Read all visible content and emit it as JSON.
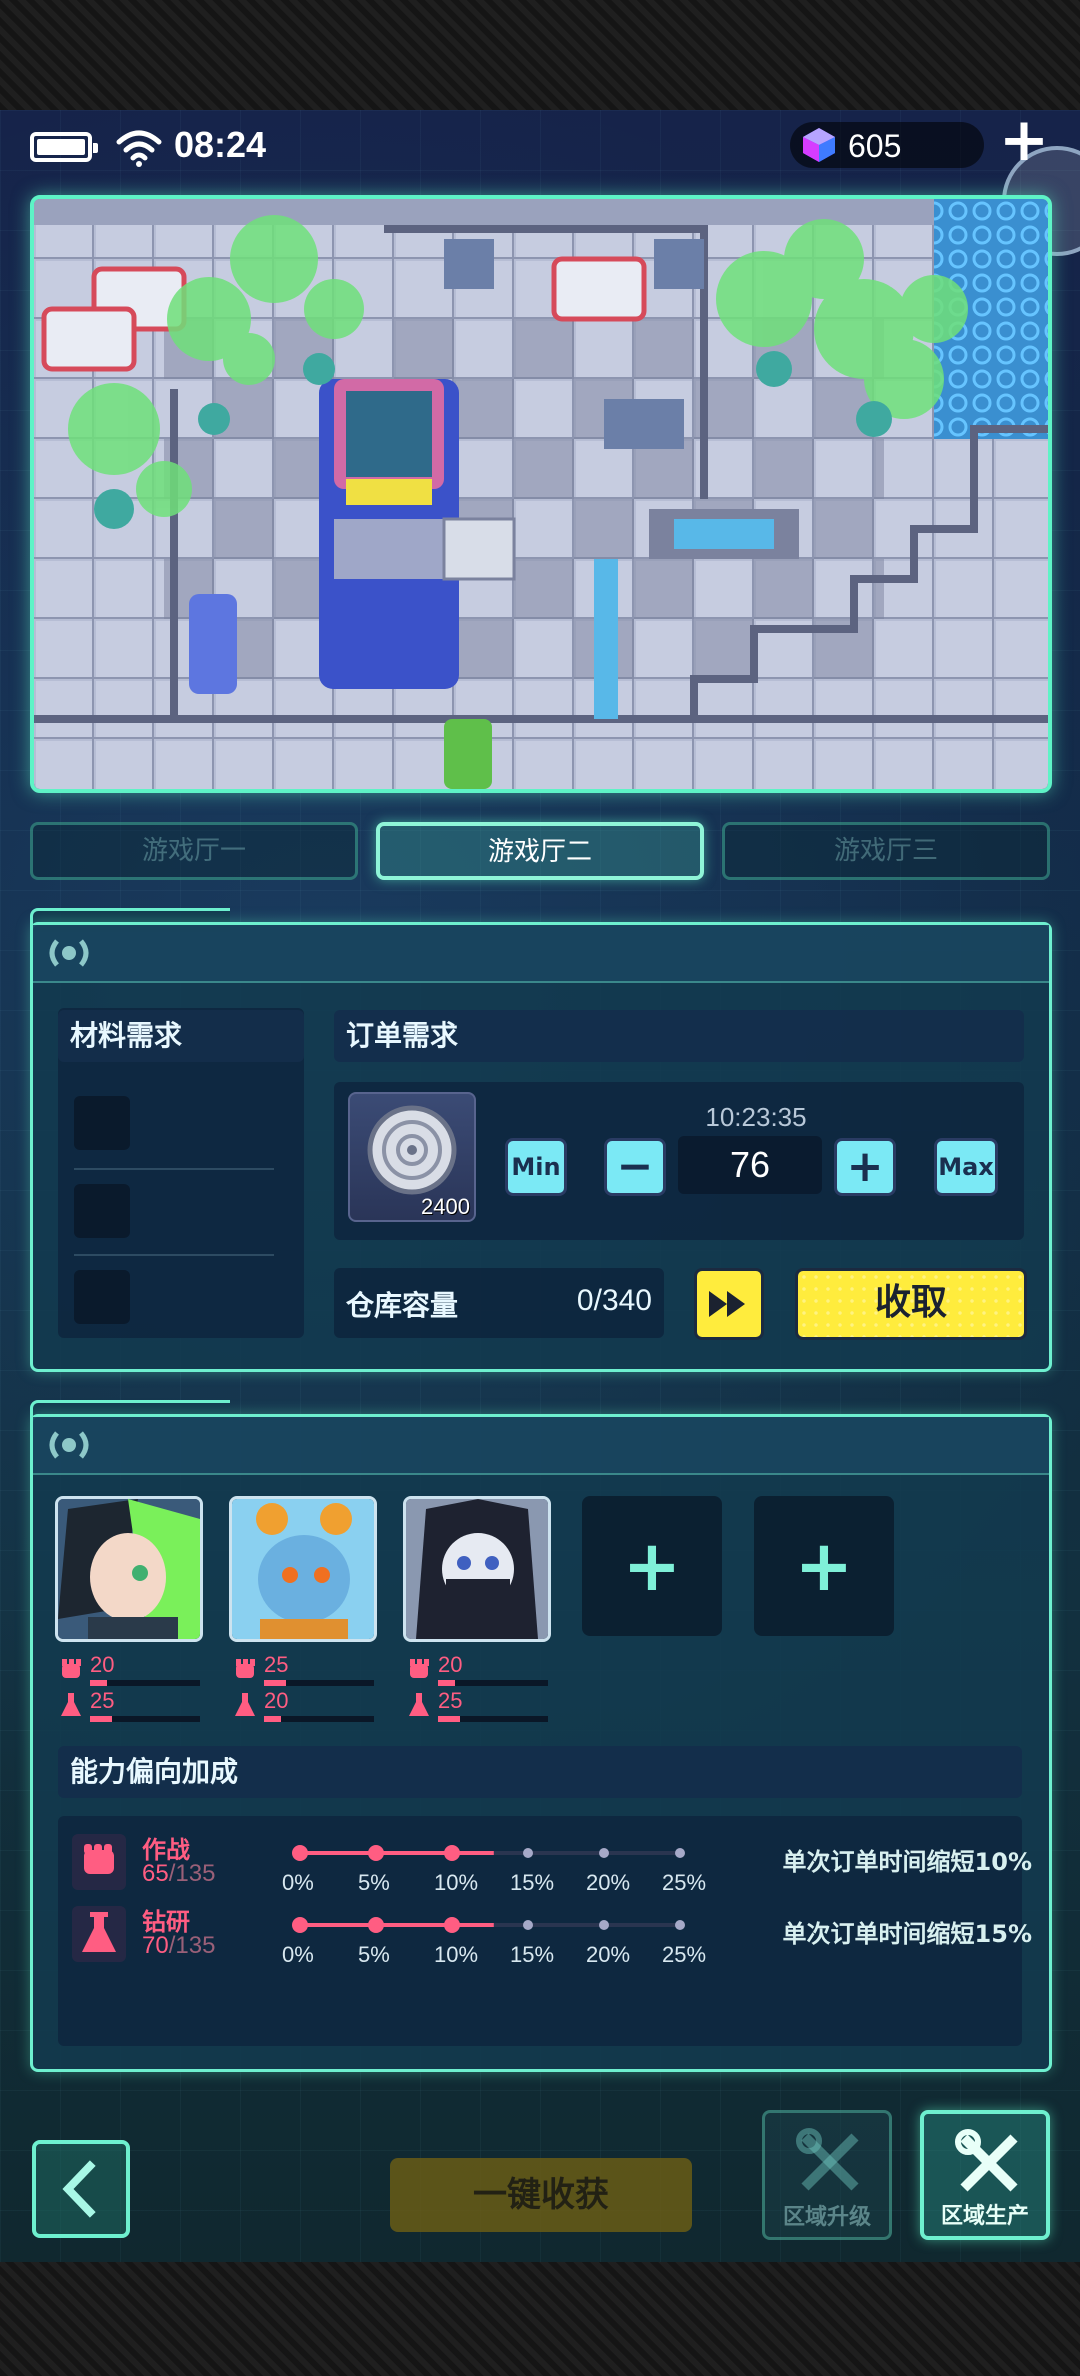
{
  "status_bar": {
    "time": "08:24",
    "gem_count": "605",
    "add_label": "+"
  },
  "hall_tabs": [
    {
      "label": "游戏厅一",
      "active": false
    },
    {
      "label": "游戏厅二",
      "active": true
    },
    {
      "label": "游戏厅三",
      "active": false
    }
  ],
  "production": {
    "materials_title": "材料需求",
    "orders_title": "订单需求",
    "order": {
      "item_icon": "coin-disc-icon",
      "item_qty": "2400",
      "timer": "10:23:35",
      "quantity": "76",
      "min_label": "Min",
      "minus_label": "−",
      "plus_label": "+",
      "max_label": "Max"
    },
    "storage_label": "仓库容量",
    "storage_value": "0/340",
    "collect_label": "收取"
  },
  "staff": {
    "members": [
      {
        "combat": "20",
        "research": "25",
        "combat_fill": 0.15,
        "research_fill": 0.2
      },
      {
        "combat": "25",
        "research": "20",
        "combat_fill": 0.2,
        "research_fill": 0.15
      },
      {
        "combat": "20",
        "research": "25",
        "combat_fill": 0.15,
        "research_fill": 0.2
      }
    ],
    "empty_slot_label": "+",
    "bonus_title": "能力偏向加成",
    "bonuses": [
      {
        "name": "作战",
        "value": "65",
        "max": "/135",
        "reached_steps": 3,
        "desc": "单次订单时间缩短10%"
      },
      {
        "name": "钻研",
        "value": "70",
        "max": "/135",
        "reached_steps": 3,
        "desc": "单次订单时间缩短15%"
      }
    ],
    "steps": [
      "0%",
      "5%",
      "10%",
      "15%",
      "20%",
      "25%"
    ]
  },
  "bottom": {
    "harvest_label": "一键收获",
    "upgrade_label": "区域升级",
    "produce_label": "区域生产"
  },
  "colors": {
    "accent": "#6ef0cf",
    "yellow": "#ffec3d",
    "pink": "#ff5d82",
    "cyan_btn": "#7be9f5"
  }
}
